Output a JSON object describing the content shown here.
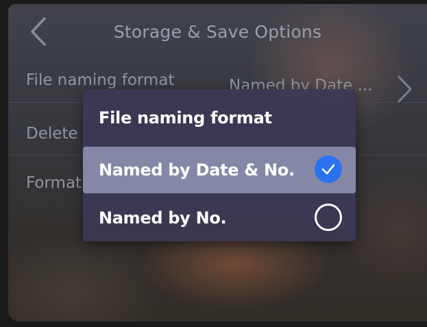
{
  "header": {
    "title": "Storage & Save Options",
    "back_icon": "chevron-left-icon"
  },
  "settings": {
    "rows": [
      {
        "label": "File naming format",
        "value": "Named by Date ...",
        "icon": "chevron-right-icon"
      },
      {
        "label": "Delete"
      },
      {
        "label": "Format"
      }
    ]
  },
  "dialog": {
    "title": "File naming format",
    "options": [
      {
        "label": "Named by Date & No.",
        "selected": true
      },
      {
        "label": "Named by No.",
        "selected": false
      }
    ]
  },
  "colors": {
    "accent": "#2a72f0",
    "dialog_bg": "#3a3854",
    "selected_row": "#8488a6"
  }
}
